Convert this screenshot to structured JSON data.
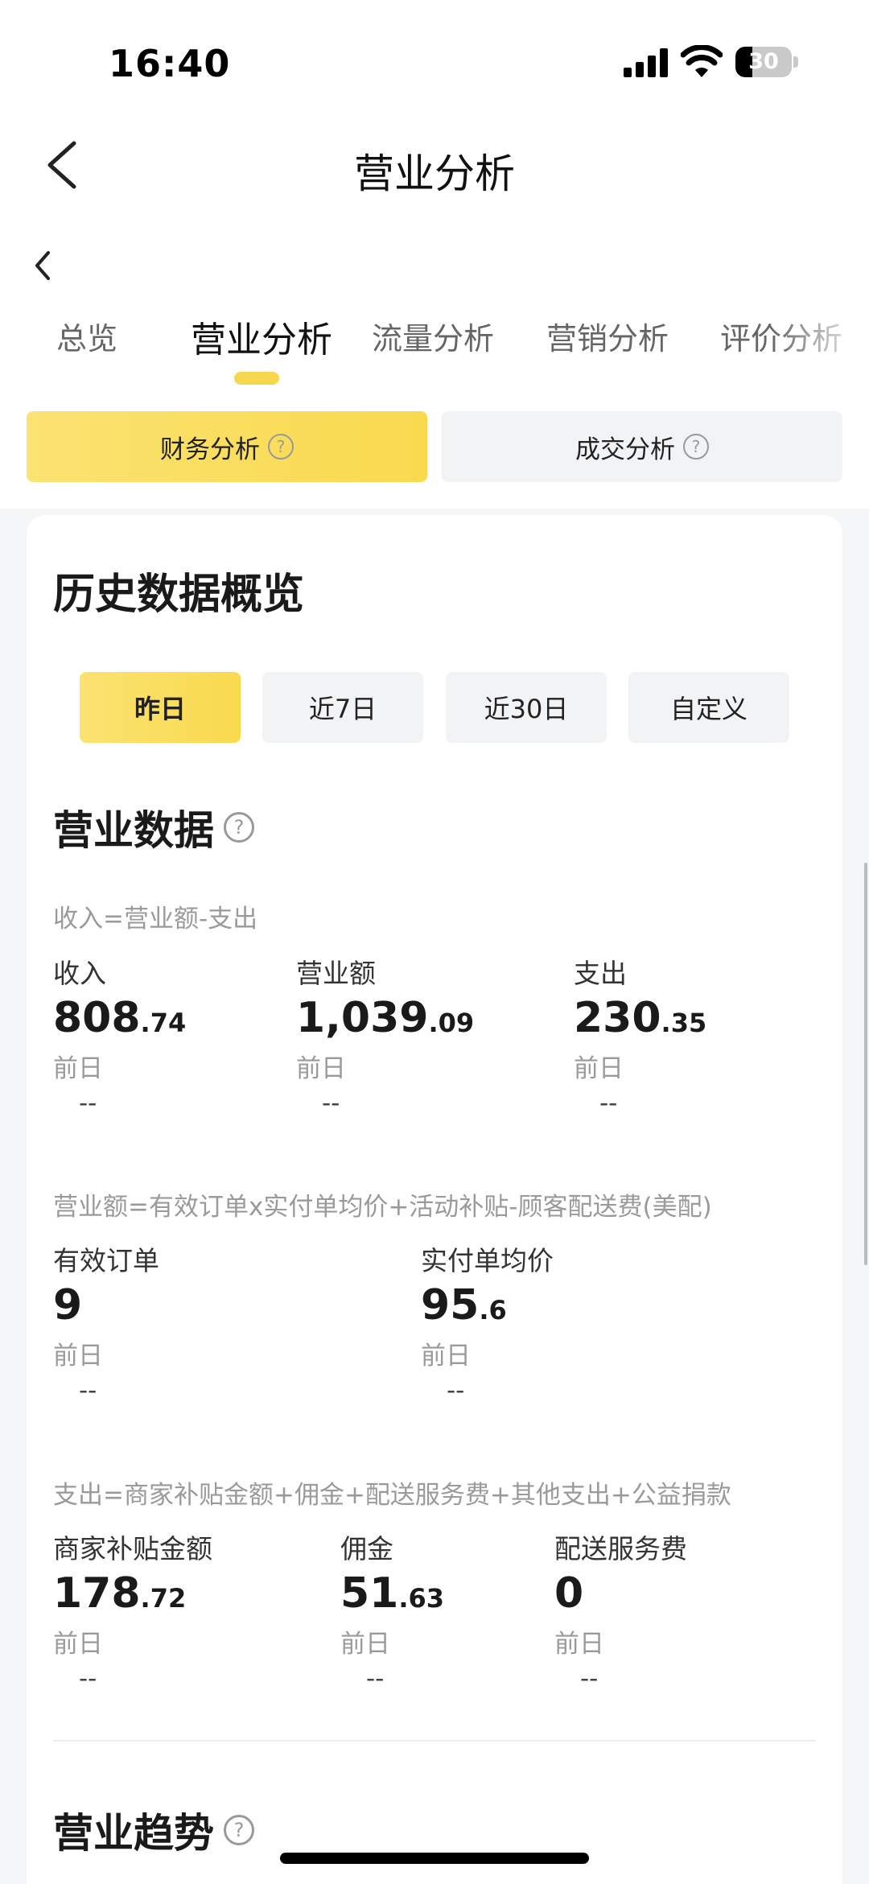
{
  "status_bar": {
    "time": "16:40",
    "battery": "30"
  },
  "header": {
    "title": "营业分析"
  },
  "tabs": [
    {
      "label": "总览"
    },
    {
      "label": "营业分析"
    },
    {
      "label": "流量分析"
    },
    {
      "label": "营销分析"
    },
    {
      "label": "评价分析"
    }
  ],
  "segments": {
    "finance": "财务分析",
    "deal": "成交分析"
  },
  "overview": {
    "title": "历史数据概览",
    "ranges": [
      "昨日",
      "近7日",
      "近30日",
      "自定义"
    ]
  },
  "business": {
    "title": "营业数据",
    "formula1": "收入=营业额-支出",
    "row1": [
      {
        "label": "收入",
        "int": "808",
        "dec": ".74",
        "prev_label": "前日",
        "prev_value": "--"
      },
      {
        "label": "营业额",
        "int": "1,039",
        "dec": ".09",
        "prev_label": "前日",
        "prev_value": "--"
      },
      {
        "label": "支出",
        "int": "230",
        "dec": ".35",
        "prev_label": "前日",
        "prev_value": "--"
      }
    ],
    "formula2": "营业额=有效订单x实付单均价+活动补贴-顾客配送费(美配)",
    "row2": [
      {
        "label": "有效订单",
        "int": "9",
        "dec": "",
        "prev_label": "前日",
        "prev_value": "--"
      },
      {
        "label": "实付单均价",
        "int": "95",
        "dec": ".6",
        "prev_label": "前日",
        "prev_value": "--"
      }
    ],
    "formula3": "支出=商家补贴金额+佣金+配送服务费+其他支出+公益捐款",
    "row3": [
      {
        "label": "商家补贴金额",
        "int": "178",
        "dec": ".72",
        "prev_label": "前日",
        "prev_value": "--"
      },
      {
        "label": "佣金",
        "int": "51",
        "dec": ".63",
        "prev_label": "前日",
        "prev_value": "--"
      },
      {
        "label": "配送服务费",
        "int": "0",
        "dec": "",
        "prev_label": "前日",
        "prev_value": "--"
      }
    ]
  },
  "trend": {
    "title": "营业趋势"
  },
  "icons": {
    "help": "?"
  }
}
